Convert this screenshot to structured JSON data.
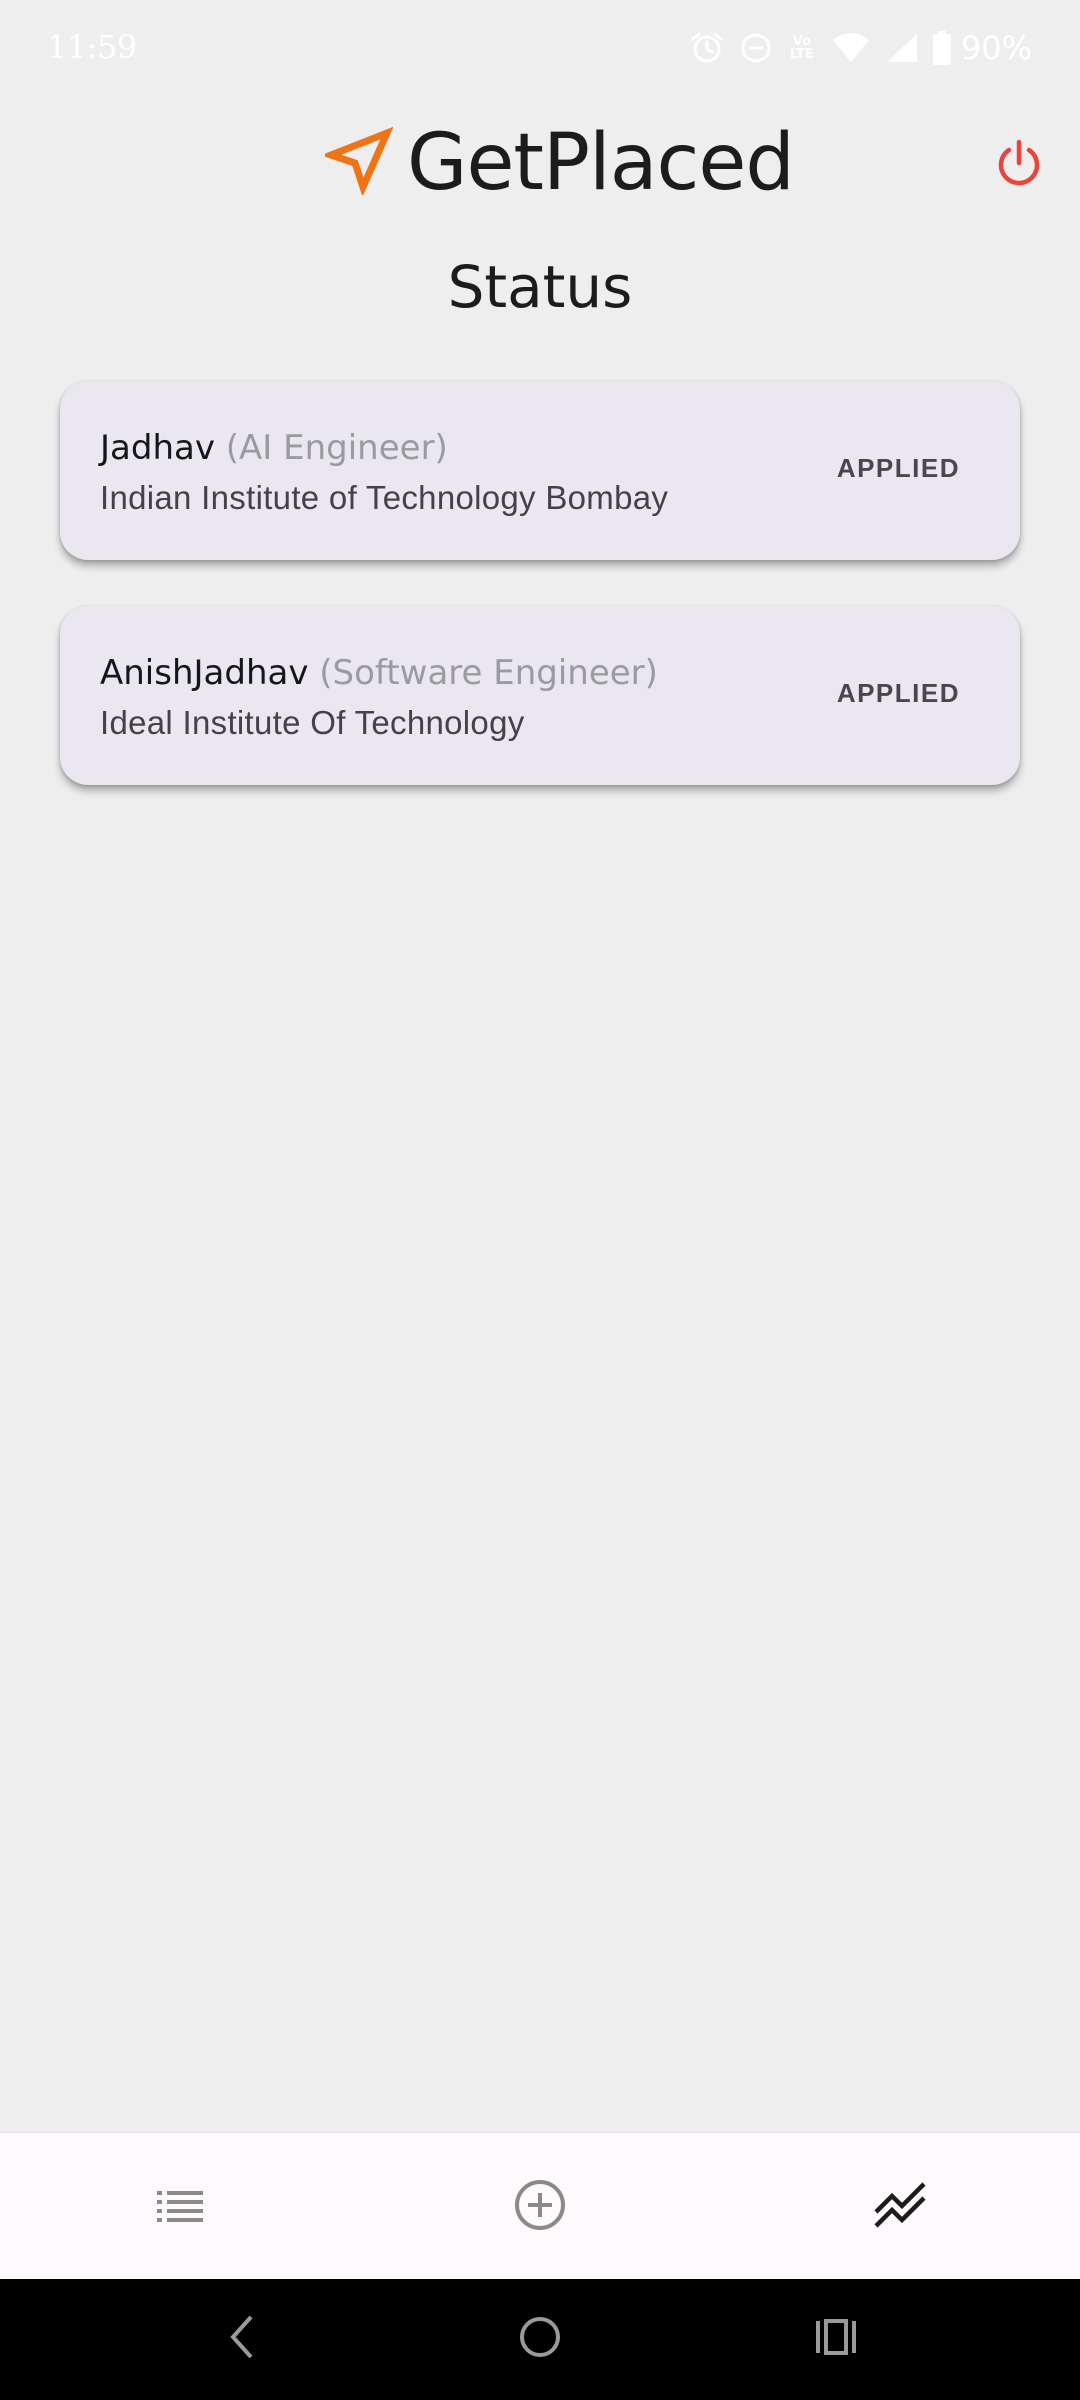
{
  "status_bar": {
    "time": "11:59",
    "volte_line1": "Vo",
    "volte_line2": "LTE",
    "battery": "90%",
    "icons": [
      "alarm-icon",
      "dnd-icon",
      "volte-icon",
      "wifi-icon",
      "signal-icon",
      "battery-icon"
    ]
  },
  "header": {
    "app_name": "GetPlaced",
    "logo_icon": "navigation-arrow-icon",
    "logo_color": "#f07316",
    "power_icon": "power-icon",
    "power_color": "#e8453c"
  },
  "page": {
    "title": "Status"
  },
  "applications": [
    {
      "name": "Jadhav",
      "role": "(AI Engineer)",
      "institute": "Indian Institute of Technology Bombay",
      "status": "APPLIED"
    },
    {
      "name": "AnishJadhav",
      "role": "(Software Engineer)",
      "institute": "Ideal Institute Of Technology",
      "status": "APPLIED"
    }
  ],
  "bottom_nav": {
    "items": [
      {
        "name": "list",
        "icon": "list-icon",
        "active": false
      },
      {
        "name": "add",
        "icon": "add-circle-icon",
        "active": false
      },
      {
        "name": "status",
        "icon": "trending-icon",
        "active": true
      }
    ],
    "active_color": "#1c1c1c",
    "inactive_color": "#8a8a8a"
  },
  "system_nav": {
    "icons": [
      "back-icon",
      "home-icon",
      "recents-icon"
    ]
  }
}
